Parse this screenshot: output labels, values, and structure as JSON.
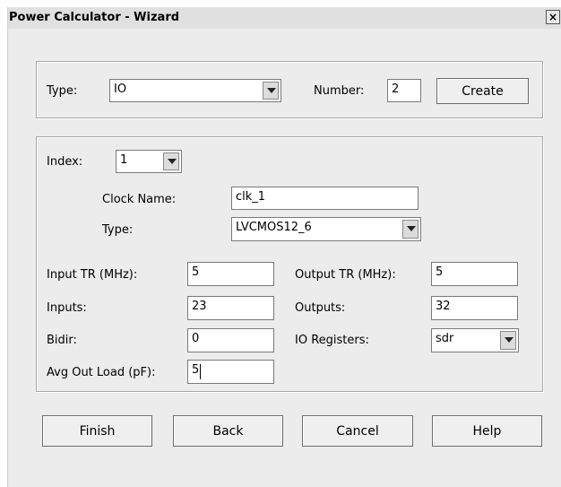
{
  "window": {
    "title": "Power Calculator - Wizard",
    "close_glyph": "×"
  },
  "top_panel": {
    "type_label": "Type:",
    "type_value": "IO",
    "number_label": "Number:",
    "number_value": "2",
    "create_button": "Create"
  },
  "detail_panel": {
    "index_label": "Index:",
    "index_value": "1",
    "clock_name_label": "Clock Name:",
    "clock_name_value": "clk_1",
    "type_label": "Type:",
    "type_value": "LVCMOS12_6",
    "input_tr_label": "Input TR (MHz):",
    "input_tr_value": "5",
    "output_tr_label": "Output TR (MHz):",
    "output_tr_value": "5",
    "inputs_label": "Inputs:",
    "inputs_value": "23",
    "outputs_label": "Outputs:",
    "outputs_value": "32",
    "bidir_label": "Bidir:",
    "bidir_value": "0",
    "io_registers_label": "IO Registers:",
    "io_registers_value": "sdr",
    "avg_out_load_label": "Avg Out Load (pF):",
    "avg_out_load_value": "5"
  },
  "buttons": {
    "finish": "Finish",
    "back": "Back",
    "cancel": "Cancel",
    "help": "Help"
  }
}
